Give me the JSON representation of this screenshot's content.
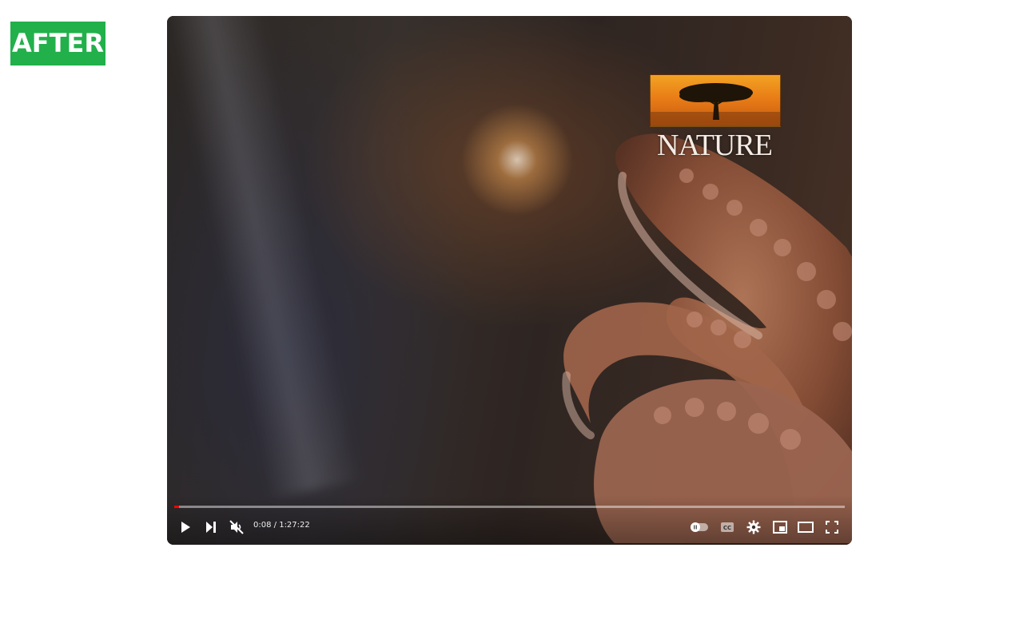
{
  "badge": {
    "label": "AFTER",
    "color": "#22b04b"
  },
  "video": {
    "watermark_text": "NATURE",
    "progress_fraction": 0.007
  },
  "controls": {
    "current_time": "0:08",
    "separator": " / ",
    "duration": "1:27:22",
    "play_icon": "play-icon",
    "next_icon": "next-icon",
    "mute_icon": "muted-volume-icon",
    "autoplay_icon": "autoplay-toggle-icon",
    "captions_icon": "captions-icon",
    "settings_icon": "gear-icon",
    "miniplayer_icon": "miniplayer-icon",
    "theater_icon": "theater-mode-icon",
    "fullscreen_icon": "fullscreen-icon",
    "progress_color": "#ff0000"
  }
}
